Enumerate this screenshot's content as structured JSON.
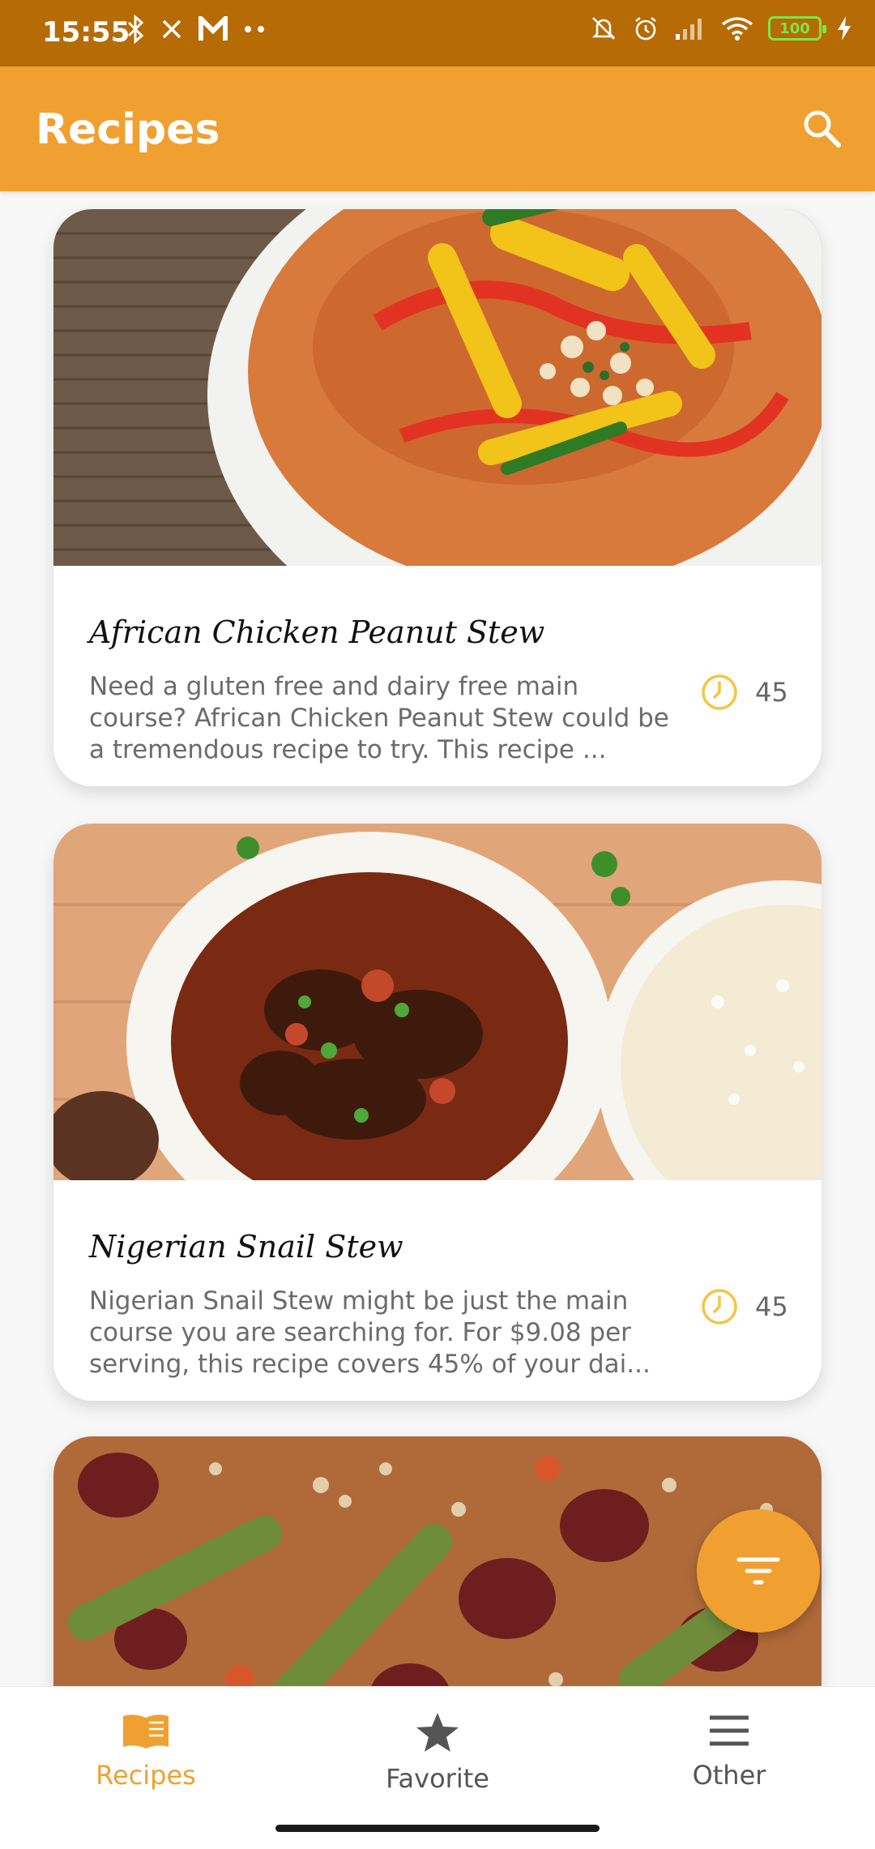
{
  "status_bar": {
    "time": "15:55",
    "left_icons": [
      "bluetooth-icon",
      "close-icon",
      "gmail-icon",
      "more-dots-icon"
    ],
    "right_icons": [
      "mute-icon",
      "alarm-icon",
      "signal-icon",
      "wifi-icon",
      "battery-icon",
      "charging-icon"
    ],
    "battery_level": "100"
  },
  "app_bar": {
    "title": "Recipes",
    "search_icon": "search-icon"
  },
  "colors": {
    "primary": "#F0A030",
    "status_bar": "#B66B05",
    "accent_yellow": "#F5C542",
    "nav_active": "#F0A030",
    "nav_inactive": "#555555"
  },
  "recipes": [
    {
      "title": "African Chicken Peanut Stew",
      "description": "Need a gluten free and dairy free main course? African Chicken Peanut Stew could be a tremendous recipe to try. This recipe ...",
      "minutes": "45"
    },
    {
      "title": "Nigerian Snail Stew",
      "description": "Nigerian Snail Stew might be just the main course you are searching for. For $9.08 per serving, this recipe covers 45% of your dai...",
      "minutes": "45"
    }
  ],
  "fab": {
    "icon": "filter-icon"
  },
  "bottom_nav": {
    "items": [
      {
        "label": "Recipes",
        "icon": "book-icon",
        "active": true
      },
      {
        "label": "Favorite",
        "icon": "star-icon",
        "active": false
      },
      {
        "label": "Other",
        "icon": "menu-icon",
        "active": false
      }
    ]
  }
}
